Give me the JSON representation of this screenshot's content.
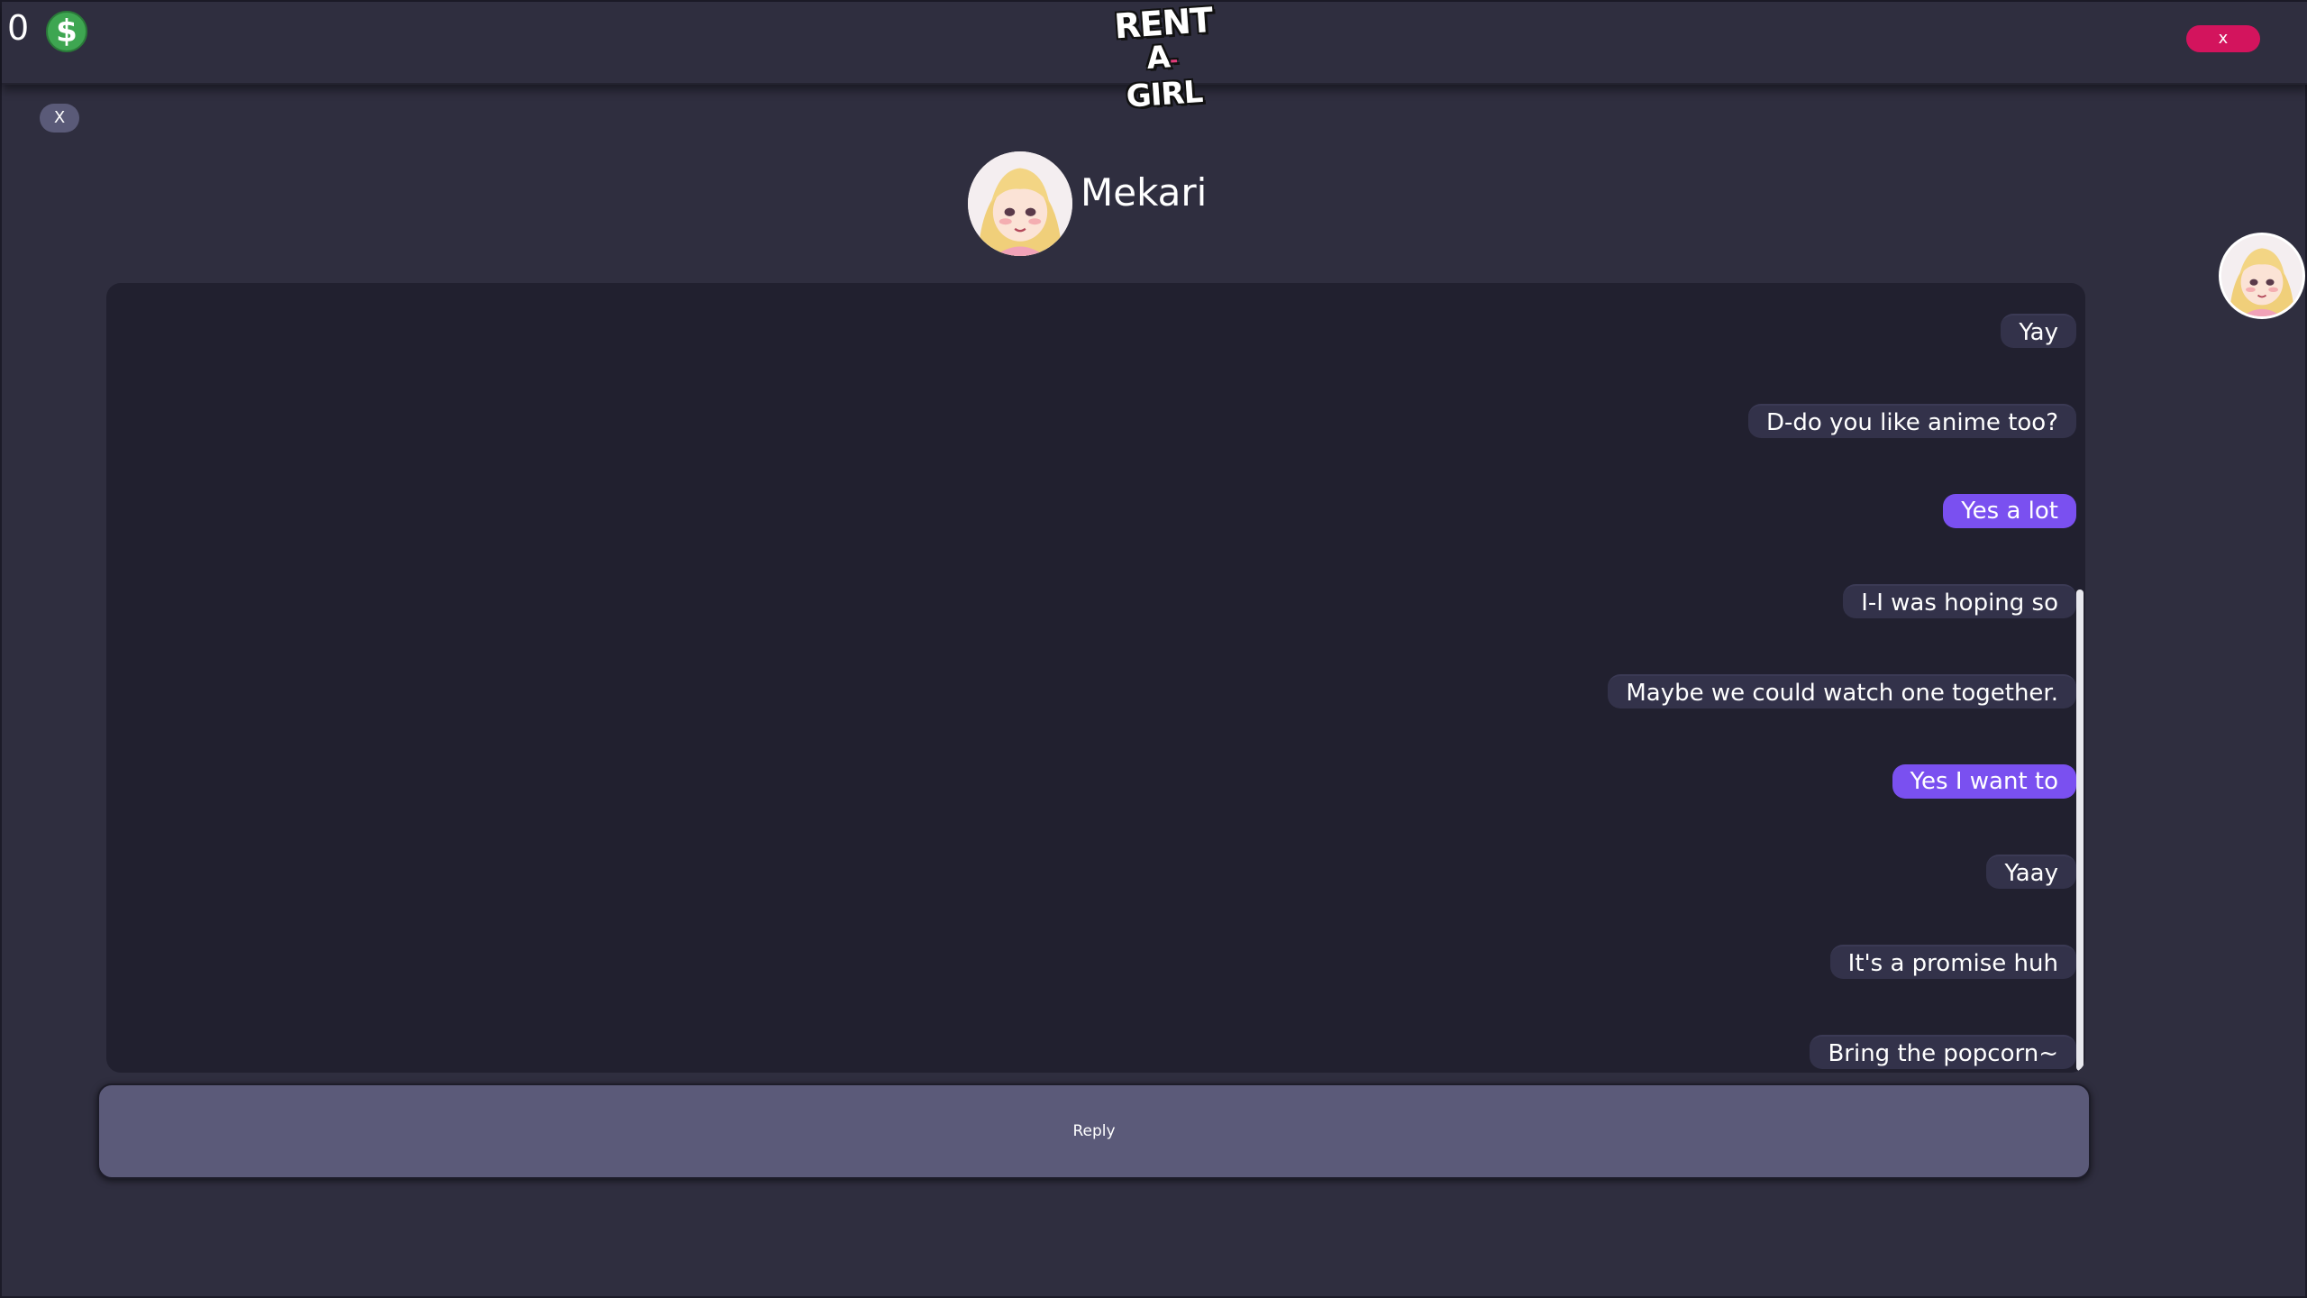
{
  "topbar": {
    "money_amount": "0",
    "money_icon": "dollar-icon",
    "logo_line1": "RENT",
    "logo_line2_a": "A",
    "logo_line2_dash": "-",
    "logo_line2_b": "GIRL",
    "close_label": "x"
  },
  "side": {
    "close_label": "X",
    "avatar_icon": "girl-avatar-icon"
  },
  "header": {
    "contact_name": "Mekari",
    "avatar_icon": "girl-avatar-icon"
  },
  "messages": [
    {
      "text": "Yay",
      "from": "them"
    },
    {
      "text": "D-do you like anime too?",
      "from": "them"
    },
    {
      "text": "Yes a lot",
      "from": "me"
    },
    {
      "text": "I-I was hoping so",
      "from": "them"
    },
    {
      "text": "Maybe we could watch one together.",
      "from": "them"
    },
    {
      "text": "Yes I want to",
      "from": "me"
    },
    {
      "text": "Yaay",
      "from": "them"
    },
    {
      "text": "It's a promise huh",
      "from": "them"
    },
    {
      "text": "Bring the popcorn~",
      "from": "them"
    }
  ],
  "reply": {
    "label": "Reply"
  },
  "colors": {
    "background": "#2f2e3f",
    "chat_panel": "#21202f",
    "bubble_them": "#33324a",
    "bubble_me": "#7a50f0",
    "close_red": "#d3145d",
    "money_green": "#3ea651",
    "reply_button": "#5b5a79"
  }
}
